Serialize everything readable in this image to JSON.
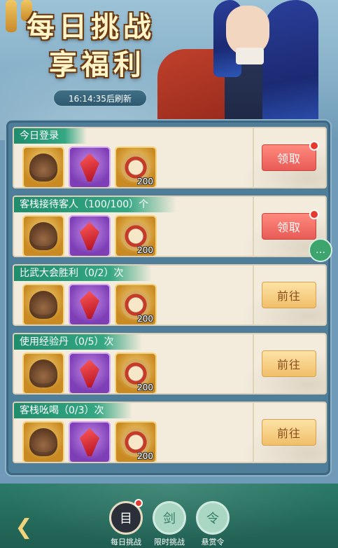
{
  "header": {
    "title_line1": "每日挑战",
    "title_line2": "享福利",
    "refresh_timer": "16:14:35后刷新"
  },
  "tasks": [
    {
      "label": "今日登录",
      "progress": "",
      "suffix": "",
      "button": "领取",
      "button_type": "claim",
      "has_badge": true,
      "rewards": [
        {
          "icon": "feather-icon",
          "qty": ""
        },
        {
          "icon": "ruby-gem-icon",
          "qty": ""
        },
        {
          "icon": "medal-icon",
          "qty": "200"
        }
      ]
    },
    {
      "label": "客栈接待客人",
      "progress": "（100/100）",
      "suffix": "个",
      "button": "领取",
      "button_type": "claim",
      "has_badge": true,
      "rewards": [
        {
          "icon": "feather-icon",
          "qty": ""
        },
        {
          "icon": "ruby-gem-icon",
          "qty": ""
        },
        {
          "icon": "medal-icon",
          "qty": "200"
        }
      ]
    },
    {
      "label": "比武大会胜利",
      "progress": "（0/2）",
      "suffix": "次",
      "button": "前往",
      "button_type": "goto",
      "has_badge": false,
      "rewards": [
        {
          "icon": "feather-icon",
          "qty": ""
        },
        {
          "icon": "ruby-gem-icon",
          "qty": ""
        },
        {
          "icon": "medal-icon",
          "qty": "200"
        }
      ]
    },
    {
      "label": "使用经验丹",
      "progress": "（0/5）",
      "suffix": "次",
      "button": "前往",
      "button_type": "goto",
      "has_badge": false,
      "rewards": [
        {
          "icon": "feather-icon",
          "qty": ""
        },
        {
          "icon": "ruby-gem-icon",
          "qty": ""
        },
        {
          "icon": "medal-icon",
          "qty": "200"
        }
      ]
    },
    {
      "label": "客栈吆喝",
      "progress": "（0/3）",
      "suffix": "次",
      "button": "前往",
      "button_type": "goto",
      "has_badge": false,
      "rewards": [
        {
          "icon": "feather-icon",
          "qty": ""
        },
        {
          "icon": "ruby-gem-icon",
          "qty": ""
        },
        {
          "icon": "medal-icon",
          "qty": "200"
        }
      ]
    }
  ],
  "bottom_nav": {
    "back_icon": "back-arrow-icon",
    "tabs": [
      {
        "label": "每日挑战",
        "icon": "scroll-calendar-icon",
        "active": true,
        "has_badge": true
      },
      {
        "label": "限时挑战",
        "icon": "sword-scroll-icon",
        "active": false,
        "has_badge": false
      },
      {
        "label": "悬赏令",
        "icon": "bounty-emblem-icon",
        "active": false,
        "has_badge": false
      }
    ]
  },
  "side": {
    "chat_icon": "chat-bubble-icon"
  },
  "colors": {
    "claim_button": "#e85b57",
    "goto_button": "#f0bf6a",
    "task_label_green": "#1f8d6c",
    "badge_red": "#e53b2f"
  }
}
